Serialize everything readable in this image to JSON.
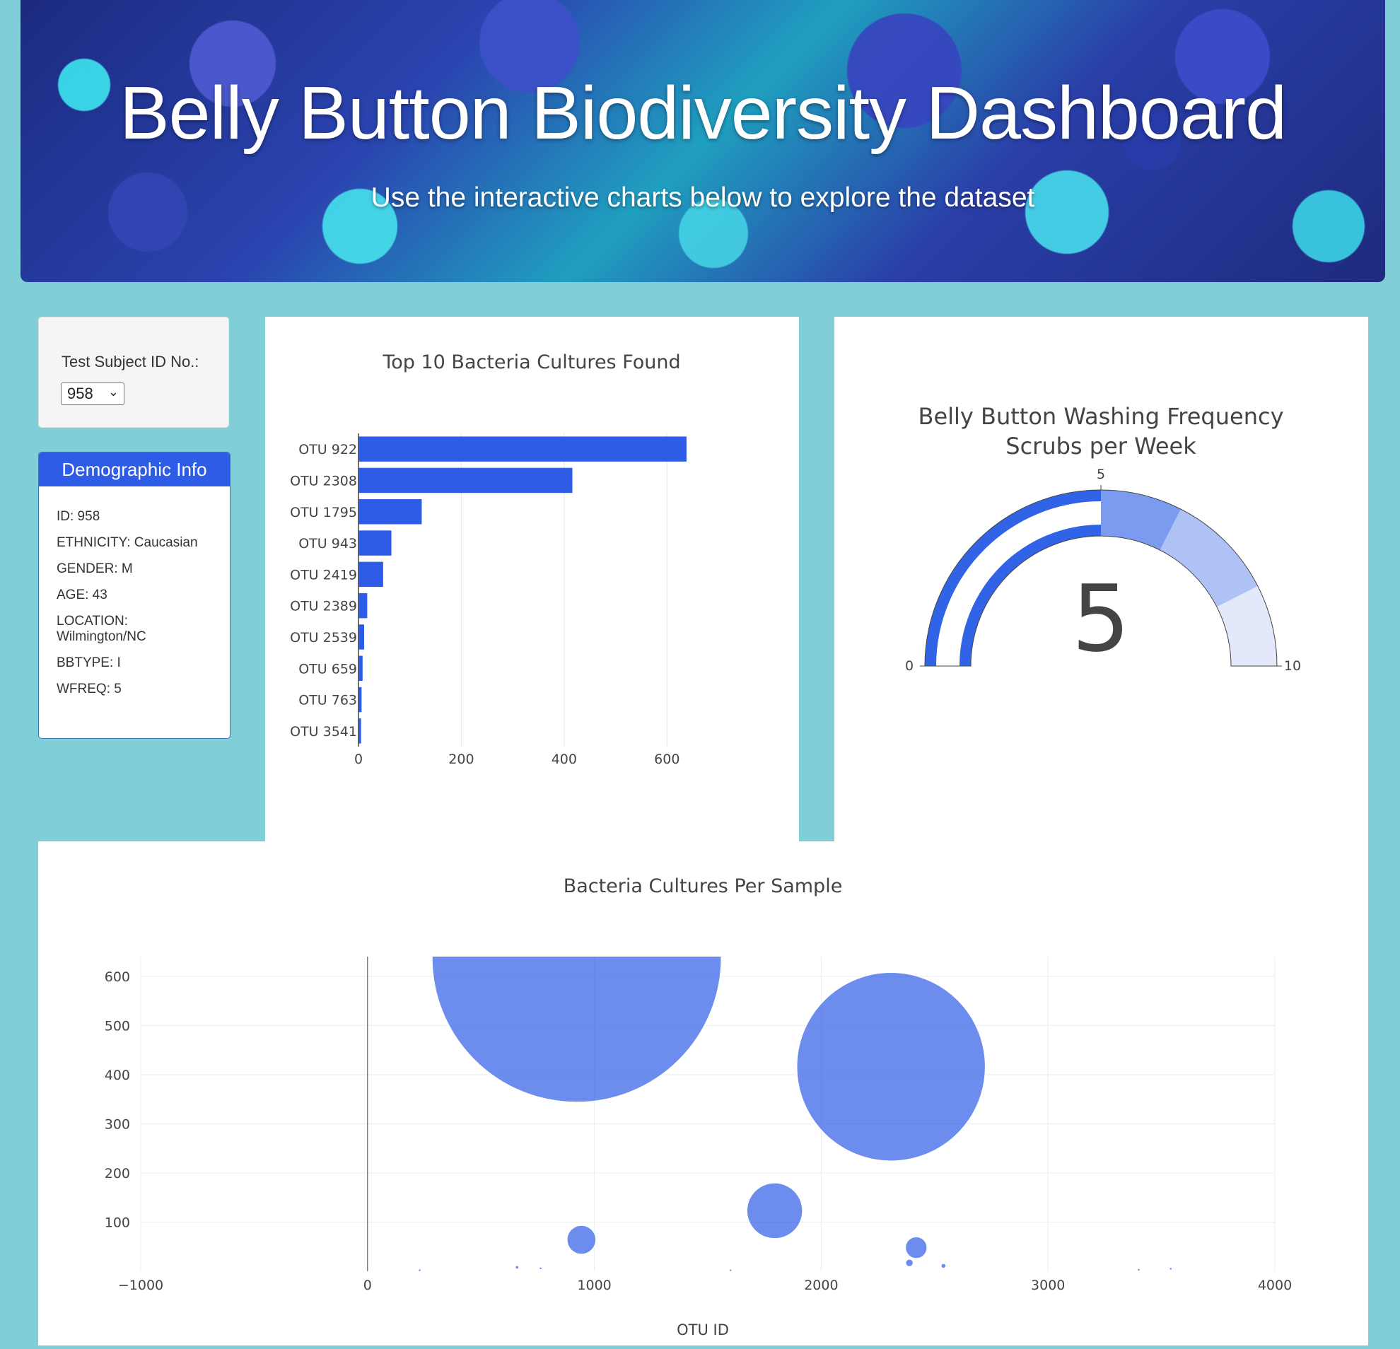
{
  "header": {
    "title": "Belly Button Biodiversity Dashboard",
    "subtitle": "Use the interactive charts below to explore the dataset"
  },
  "selector": {
    "label": "Test Subject ID No.:",
    "value": "958"
  },
  "demographics": {
    "heading": "Demographic Info",
    "lines": [
      "ID: 958",
      "ETHNICITY: Caucasian",
      "GENDER: M",
      "AGE: 43",
      "LOCATION: Wilmington/NC",
      "BBTYPE: I",
      "WFREQ: 5"
    ]
  },
  "colors": {
    "bar": "#2e5ce6",
    "page_bg": "#80cfd8",
    "panel_head": "#2e5ce6"
  },
  "chart_data": [
    {
      "type": "bar",
      "orientation": "h",
      "title": "Top 10 Bacteria Cultures Found",
      "categories": [
        "OTU 922",
        "OTU 2308",
        "OTU 1795",
        "OTU 943",
        "OTU 2419",
        "OTU 2389",
        "OTU 2539",
        "OTU 659",
        "OTU 763",
        "OTU 3541"
      ],
      "values": [
        638,
        416,
        123,
        64,
        48,
        17,
        11,
        8,
        6,
        5
      ],
      "xlim": [
        0,
        700
      ],
      "xticks": [
        0,
        200,
        400,
        600
      ],
      "grid": true
    },
    {
      "type": "gauge",
      "title": "Belly Button Washing Frequency",
      "subtitle": "Scrubs per Week",
      "value": 5,
      "value_label": "5",
      "range": [
        0,
        10
      ],
      "tick_labels": [
        "0",
        "5",
        "10"
      ],
      "steps": [
        {
          "from": 0,
          "to": 5,
          "color": "#3163e6"
        },
        {
          "from": 5,
          "to": 6.5,
          "color": "#7b9bf0"
        },
        {
          "from": 6.5,
          "to": 8.5,
          "color": "#afc2f6"
        },
        {
          "from": 8.5,
          "to": 10,
          "color": "#e3e9fb"
        }
      ]
    },
    {
      "type": "scatter",
      "title": "Bacteria Cultures Per Sample",
      "xlabel": "OTU ID",
      "ylabel": "",
      "xlim": [
        -1000,
        4000
      ],
      "ylim": [
        0,
        640
      ],
      "xticks": [
        -1000,
        0,
        1000,
        2000,
        3000,
        4000
      ],
      "yticks": [
        100,
        200,
        300,
        400,
        500,
        600
      ],
      "grid": true,
      "points": [
        {
          "x": 922,
          "y": 638,
          "r": 638
        },
        {
          "x": 2308,
          "y": 416,
          "r": 416
        },
        {
          "x": 1795,
          "y": 123,
          "r": 123
        },
        {
          "x": 943,
          "y": 64,
          "r": 64
        },
        {
          "x": 2419,
          "y": 48,
          "r": 48
        },
        {
          "x": 2389,
          "y": 17,
          "r": 17
        },
        {
          "x": 2539,
          "y": 11,
          "r": 11
        },
        {
          "x": 659,
          "y": 8,
          "r": 8
        },
        {
          "x": 763,
          "y": 6,
          "r": 6
        },
        {
          "x": 3541,
          "y": 5,
          "r": 5
        },
        {
          "x": 3400,
          "y": 3,
          "r": 3
        },
        {
          "x": 230,
          "y": 2,
          "r": 2
        },
        {
          "x": 1600,
          "y": 2,
          "r": 2
        }
      ]
    }
  ]
}
